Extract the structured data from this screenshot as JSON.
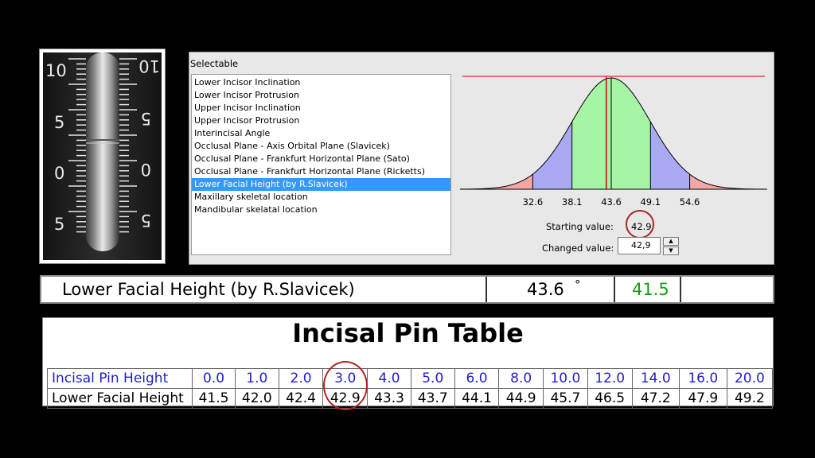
{
  "pin_photo": {
    "left_scale_labels": [
      "10",
      "5",
      "0",
      "5"
    ],
    "right_scale_labels": [
      "10",
      "5",
      "0",
      "5"
    ]
  },
  "selectable": {
    "title": "Selectable",
    "items": [
      "Lower Incisor Inclination",
      "Lower Incisor Protrusion",
      "Upper Incisor Inclination",
      "Upper Incisor Protrusion",
      "Interincisal Angle",
      "Occlusal Plane - Axis Orbital Plane (Slavicek)",
      "Occlusal Plane - Frankfurt Horizontal Plane (Sato)",
      "Occlusal Plane - Frankfurt Horizontal Plane (Ricketts)",
      "Lower Facial Height (by R.Slavicek)",
      "Maxillary skeletal location",
      "Mandibular skelatal location"
    ],
    "selected_index": 8
  },
  "distribution": {
    "tick_labels": [
      "32.6",
      "38.1",
      "43.6",
      "49.1",
      "54.6"
    ],
    "colors": {
      "tail": "#f4a7a7",
      "band": "#aaaaf4",
      "center": "#a6f4a6",
      "marker": "#cc0000"
    }
  },
  "controls": {
    "starting_label": "Starting value:",
    "starting_value": "42.9",
    "changed_label": "Changed value:",
    "changed_value": "42,9",
    "spin_up": "▲",
    "spin_down": "▼"
  },
  "result": {
    "name": "Lower Facial Height (by R.Slavicek)",
    "value": "43.6",
    "unit_symbol": "°",
    "changed_value": "41.5"
  },
  "pin_table": {
    "title": "Incisal Pin Table",
    "row1_label": "Incisal Pin Height",
    "row2_label": "Lower Facial Height",
    "heights": [
      "0.0",
      "1.0",
      "2.0",
      "3.0",
      "4.0",
      "5.0",
      "6.0",
      "8.0",
      "10.0",
      "12.0",
      "14.0",
      "16.0",
      "20.0"
    ],
    "lfh_values": [
      "41.5",
      "42.0",
      "42.4",
      "42.9",
      "43.3",
      "43.7",
      "44.1",
      "44.9",
      "45.7",
      "46.5",
      "47.2",
      "47.9",
      "49.2"
    ],
    "highlighted_index": 3
  },
  "colors": {
    "accent_circle": "#b22222",
    "header_blue": "#1f1fc9",
    "changed_green": "#1a9b1a",
    "selection": "#3399ff"
  }
}
